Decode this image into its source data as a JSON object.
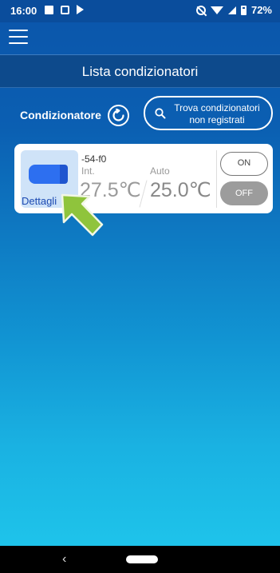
{
  "status_bar": {
    "time": "16:00",
    "battery": "72%"
  },
  "header": {
    "title": "Lista condizionatori"
  },
  "section": {
    "label": "Condizionatore",
    "find_button_label": "Trova condizionatori non registrati"
  },
  "units": [
    {
      "name": "-54-f0",
      "details_label": "Dettagli",
      "details_chevron": ">",
      "room_label": "Int.",
      "room_temp": "27.5℃",
      "mode_label": "Auto",
      "set_temp": "25.0℃",
      "on_label": "ON",
      "off_label": "OFF",
      "power_state": "off"
    }
  ],
  "nav": {
    "back_symbol": "‹"
  },
  "colors": {
    "accent_blue": "#0b55aa",
    "gradient_bottom": "#1ec3ea",
    "hint_arrow": "#8fc43c"
  },
  "icons": [
    "menu-icon",
    "refresh-icon",
    "search-icon",
    "air-conditioner-icon",
    "hint-arrow-icon"
  ]
}
